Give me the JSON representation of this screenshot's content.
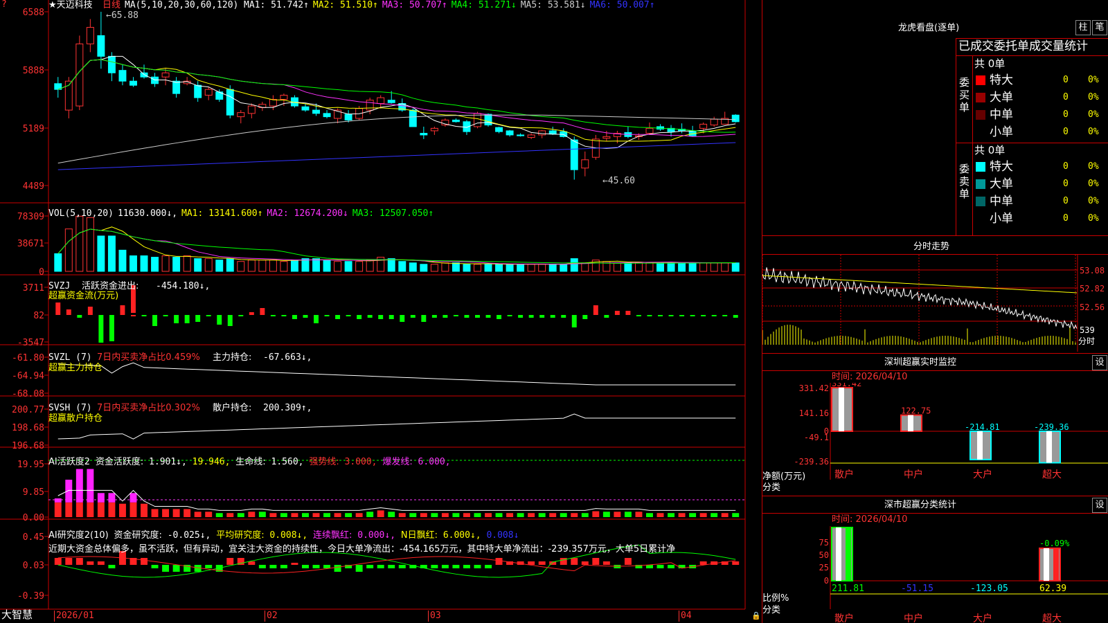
{
  "stock": {
    "name": "★天迈科技",
    "period": "日线",
    "brand": "大智慧"
  },
  "panels": {
    "kline": {
      "ma_label": "MA(5,10,20,30,60,120)",
      "ma": [
        {
          "name": "MA1",
          "value": "51.742",
          "arrow": "↑",
          "color": "#ffffff"
        },
        {
          "name": "MA2",
          "value": "51.510",
          "arrow": "↑",
          "color": "#ffff00"
        },
        {
          "name": "MA3",
          "value": "50.707",
          "arrow": "↑",
          "color": "#ff33ff"
        },
        {
          "name": "MA4",
          "value": "51.271",
          "arrow": "↓",
          "color": "#00ff00"
        },
        {
          "name": "MA5",
          "value": "53.581",
          "arrow": "↓",
          "color": "#cccccc"
        },
        {
          "name": "MA6",
          "value": "50.007",
          "arrow": "↑",
          "color": "#3333ff"
        }
      ],
      "yticks": [
        "6588",
        "5888",
        "5189",
        "4489"
      ],
      "high_label": "65.88",
      "low_label": "45.60"
    },
    "vol": {
      "label": "VOL(5,10,20)",
      "value": "11630.000↓,",
      "ma": [
        {
          "name": "MA1",
          "value": "13141.600",
          "arrow": "↑",
          "color": "#ffff00"
        },
        {
          "name": "MA2",
          "value": "12674.200",
          "arrow": "↓",
          "color": "#ff33ff"
        },
        {
          "name": "MA3",
          "value": "12507.050",
          "arrow": "↑",
          "color": "#00ff00"
        }
      ],
      "yticks": [
        "78309",
        "38671",
        "0"
      ]
    },
    "svzj": {
      "label": "SVZJ",
      "title": "活跃资金进出:",
      "value": "-454.180↓,",
      "sub": "超赢资金流(万元)",
      "yticks": [
        "3711",
        "82",
        "-3547"
      ]
    },
    "svzl": {
      "label": "SVZL (7)",
      "title": "7日内买卖净占比0.459%",
      "main_label": "主力持仓:",
      "main_value": "-67.663↓,",
      "sub": "超赢主力持仓",
      "yticks": [
        "-61.80",
        "-64.94",
        "-68.08"
      ]
    },
    "svsh": {
      "label": "SVSH (7)",
      "title": "7日内买卖净占比0.302%",
      "main_label": "散户持仓:",
      "main_value": "200.309↑,",
      "sub": "超赢散户持仓",
      "yticks": [
        "200.77",
        "198.68",
        "196.68"
      ]
    },
    "ai1": {
      "label": "AI活跃度2",
      "t1": "资金活跃度:",
      "v1": "1.901↓,",
      "v2": "19.946,",
      "t3": "生命线:",
      "v3": "1.560,",
      "t4": "强势线:",
      "v4": "3.000,",
      "t5": "爆发线:",
      "v5": "6.000,",
      "yticks": [
        "19.95",
        "9.85",
        "0.00"
      ]
    },
    "ai2": {
      "label": "AI研究度2(10)",
      "t1": "资金研究度:",
      "v1": "-0.025↓,",
      "t2": "平均研究度:",
      "v2": "0.008↓,",
      "t3": "连续飘红:",
      "v3": "0.000↓,",
      "t4": "N日飘红:",
      "v4": "6.000↓,",
      "v5": "0.008↓",
      "comment": "近期大资金总体偏多，虽不活跃，但有异动，宜关注大资金的持续性，今日大单净流出：-454.165万元，其中特大单净流出：-239.357万元，大单5日累计净",
      "yticks": [
        "0.45",
        "0.03",
        "-0.39"
      ]
    }
  },
  "x_axis": [
    "2026/01",
    "02",
    "03",
    "04"
  ],
  "right": {
    "dragon": {
      "title": "龙虎看盘(逐单)",
      "btn1": "柱",
      "btn2": "笔",
      "table_header": "已成交委托单成交量统计",
      "buy_side": "委买单",
      "sell_side": "委卖单",
      "buy_total": "共 0单",
      "sell_total": "共 0单",
      "rows_buy": [
        {
          "label": "特大",
          "count": "0",
          "pct": "0%",
          "color": "#ff0000"
        },
        {
          "label": "大单",
          "count": "0",
          "pct": "0%",
          "color": "#990000"
        },
        {
          "label": "中单",
          "count": "0",
          "pct": "0%",
          "color": "#660000"
        },
        {
          "label": "小单",
          "count": "0",
          "pct": "0%",
          "color": "#000000"
        }
      ],
      "rows_sell": [
        {
          "label": "特大",
          "count": "0",
          "pct": "0%",
          "color": "#00ffff"
        },
        {
          "label": "大单",
          "count": "0",
          "pct": "0%",
          "color": "#009999"
        },
        {
          "label": "中单",
          "count": "0",
          "pct": "0%",
          "color": "#006666"
        },
        {
          "label": "小单",
          "count": "0",
          "pct": "0%",
          "color": "#000000"
        }
      ]
    },
    "intraday": {
      "title": "分时走势",
      "yticks": [
        "53.08",
        "52.82",
        "52.56"
      ],
      "vol_value": "539",
      "vol_unit": "分时"
    },
    "sz_monitor": {
      "title": "深圳超赢实时监控",
      "btn": "设",
      "time_label": "时间: 2026/04/10",
      "yticks": [
        "331.42",
        "141.16",
        "0",
        "-49.1",
        "-239.36"
      ],
      "unit": "净额(万元)",
      "cat_label": "分类",
      "categories": [
        "散户",
        "中户",
        "大户",
        "超大"
      ],
      "values": [
        331.42,
        122.75,
        -214.81,
        -239.36
      ],
      "value_labels": [
        "331.42",
        "122.75",
        "-214.81",
        "-239.36"
      ]
    },
    "sz_class": {
      "title": "深市超赢分类统计",
      "btn": "设",
      "time_label": "时间: 2026/04/10",
      "yticks": [
        "75",
        "50",
        "25",
        "0"
      ],
      "unit": "比例%",
      "cat_label": "分类",
      "categories": [
        "散户",
        "中户",
        "大户",
        "超大"
      ],
      "bottom_values": [
        "211.81",
        "-51.15",
        "-123.05",
        "62.39"
      ],
      "top_label": "-0.09%"
    }
  },
  "chart_data": {
    "type": "candlestick",
    "candles": [
      [
        57.2,
        58.0,
        55.5,
        56.5
      ],
      [
        54.0,
        58.0,
        53.0,
        57.5
      ],
      [
        54.5,
        63.0,
        54.0,
        62.0
      ],
      [
        62.0,
        65.0,
        61.0,
        64.0
      ],
      [
        63.0,
        65.88,
        59.0,
        60.5
      ],
      [
        60.5,
        61.0,
        57.5,
        58.5
      ],
      [
        58.8,
        59.5,
        57.0,
        57.5
      ],
      [
        57.5,
        58.0,
        56.8,
        57.0
      ],
      [
        58.5,
        59.5,
        57.8,
        58.0
      ],
      [
        58.0,
        58.5,
        56.8,
        57.2
      ],
      [
        58.0,
        59.0,
        57.0,
        58.5
      ],
      [
        57.5,
        58.0,
        55.5,
        56.0
      ],
      [
        57.2,
        58.0,
        57.0,
        57.5
      ],
      [
        57.0,
        57.5,
        55.0,
        55.5
      ],
      [
        55.8,
        56.8,
        55.2,
        56.5
      ],
      [
        56.2,
        56.5,
        55.0,
        55.3
      ],
      [
        56.5,
        57.0,
        53.0,
        53.4
      ],
      [
        53.2,
        54.0,
        52.4,
        53.7
      ],
      [
        53.6,
        54.8,
        53.0,
        54.5
      ],
      [
        54.3,
        55.0,
        53.9,
        54.7
      ],
      [
        54.5,
        55.8,
        54.0,
        55.3
      ],
      [
        55.3,
        56.0,
        54.5,
        55.8
      ],
      [
        55.5,
        55.8,
        54.3,
        54.5
      ],
      [
        54.4,
        54.8,
        53.8,
        54.0
      ],
      [
        54.0,
        54.8,
        53.3,
        53.6
      ],
      [
        53.6,
        54.0,
        53.0,
        53.2
      ],
      [
        53.0,
        54.2,
        52.4,
        54.0
      ],
      [
        53.5,
        54.0,
        52.5,
        52.8
      ],
      [
        53.0,
        54.5,
        52.8,
        54.2
      ],
      [
        54.0,
        55.5,
        53.5,
        55.2
      ],
      [
        54.8,
        55.8,
        54.2,
        55.5
      ],
      [
        55.2,
        56.3,
        54.8,
        54.9
      ],
      [
        54.8,
        55.4,
        53.8,
        54.0
      ],
      [
        54.0,
        54.2,
        52.0,
        52.0
      ],
      [
        51.2,
        52.0,
        50.5,
        51.0
      ],
      [
        51.5,
        52.0,
        51.0,
        51.8
      ],
      [
        52.2,
        53.0,
        52.0,
        52.8
      ],
      [
        52.8,
        53.0,
        52.5,
        52.6
      ],
      [
        52.6,
        52.8,
        51.0,
        51.4
      ],
      [
        52.0,
        53.8,
        51.8,
        53.6
      ],
      [
        53.5,
        53.6,
        52.0,
        52.2
      ],
      [
        51.9,
        52.0,
        51.2,
        51.4
      ],
      [
        51.5,
        51.6,
        50.8,
        51.0
      ],
      [
        51.0,
        51.2,
        50.8,
        50.9
      ],
      [
        50.7,
        51.2,
        50.5,
        51.0
      ],
      [
        51.0,
        51.6,
        50.6,
        51.5
      ],
      [
        51.5,
        52.0,
        51.0,
        51.1
      ],
      [
        51.4,
        51.8,
        50.7,
        50.8
      ],
      [
        50.4,
        50.8,
        45.6,
        46.8
      ],
      [
        47.0,
        49.0,
        46.0,
        48.0
      ],
      [
        48.3,
        51.0,
        48.0,
        50.5
      ],
      [
        50.6,
        51.5,
        50.2,
        50.8
      ],
      [
        50.8,
        51.5,
        50.0,
        51.2
      ],
      [
        51.3,
        52.0,
        50.6,
        50.8
      ],
      [
        50.8,
        51.2,
        50.4,
        50.9
      ],
      [
        51.2,
        52.5,
        51.0,
        51.8
      ],
      [
        52.0,
        52.3,
        51.5,
        51.7
      ],
      [
        51.8,
        52.2,
        50.8,
        51.4
      ],
      [
        51.7,
        52.4,
        51.2,
        51.5
      ],
      [
        51.5,
        52.1,
        50.8,
        50.9
      ],
      [
        51.8,
        52.5,
        51.2,
        52.3
      ],
      [
        52.2,
        53.2,
        52.0,
        52.9
      ],
      [
        52.3,
        53.8,
        52.3,
        53.0
      ],
      [
        53.4,
        53.5,
        52.5,
        52.6
      ]
    ],
    "x": [
      "2026/01",
      "02",
      "03",
      "04"
    ]
  }
}
